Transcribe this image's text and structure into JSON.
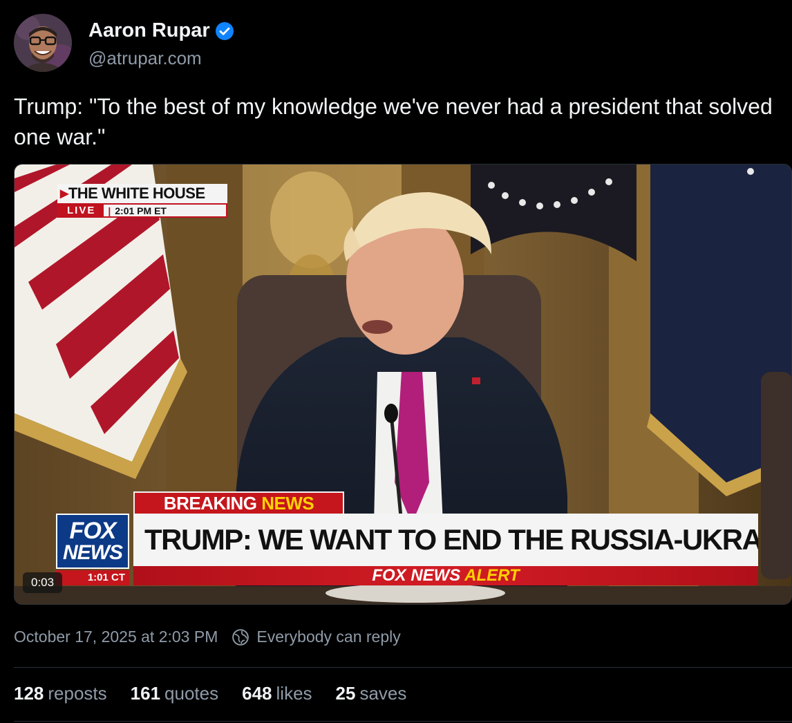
{
  "author": {
    "name": "Aaron Rupar",
    "handle": "@atrupar.com",
    "verified": true
  },
  "post": {
    "text": "Trump: \"To the best of my knowledge we've never had a president that solved one war.\""
  },
  "video": {
    "elapsed": "0:03",
    "overlay": {
      "location_title": "THE WHITE HOUSE",
      "live_label": "LIVE",
      "live_time": "2:01 PM ET",
      "breaking_word": "BREAKING",
      "breaking_news_word": "NEWS",
      "headline": "TRUMP: WE WANT TO END THE RUSSIA-UKRAINE WAR",
      "network_logo_line1": "FOX",
      "network_logo_line2": "NEWS",
      "network_clock": "1:01 CT",
      "alert_prefix": "FOX NEWS",
      "alert_word": "ALERT"
    }
  },
  "meta": {
    "date": "October 17, 2025 at 2:03 PM",
    "reply_setting": "Everybody can reply",
    "globe_icon": "globe-icon"
  },
  "stats": {
    "reposts_count": "128",
    "reposts_label": "reposts",
    "quotes_count": "161",
    "quotes_label": "quotes",
    "likes_count": "648",
    "likes_label": "likes",
    "saves_count": "25",
    "saves_label": "saves"
  },
  "colors": {
    "background": "#000000",
    "verified": "#1083fe",
    "fox_red": "#c4161c",
    "fox_blue": "#0d3a86",
    "alert_yellow": "#ffd200"
  }
}
